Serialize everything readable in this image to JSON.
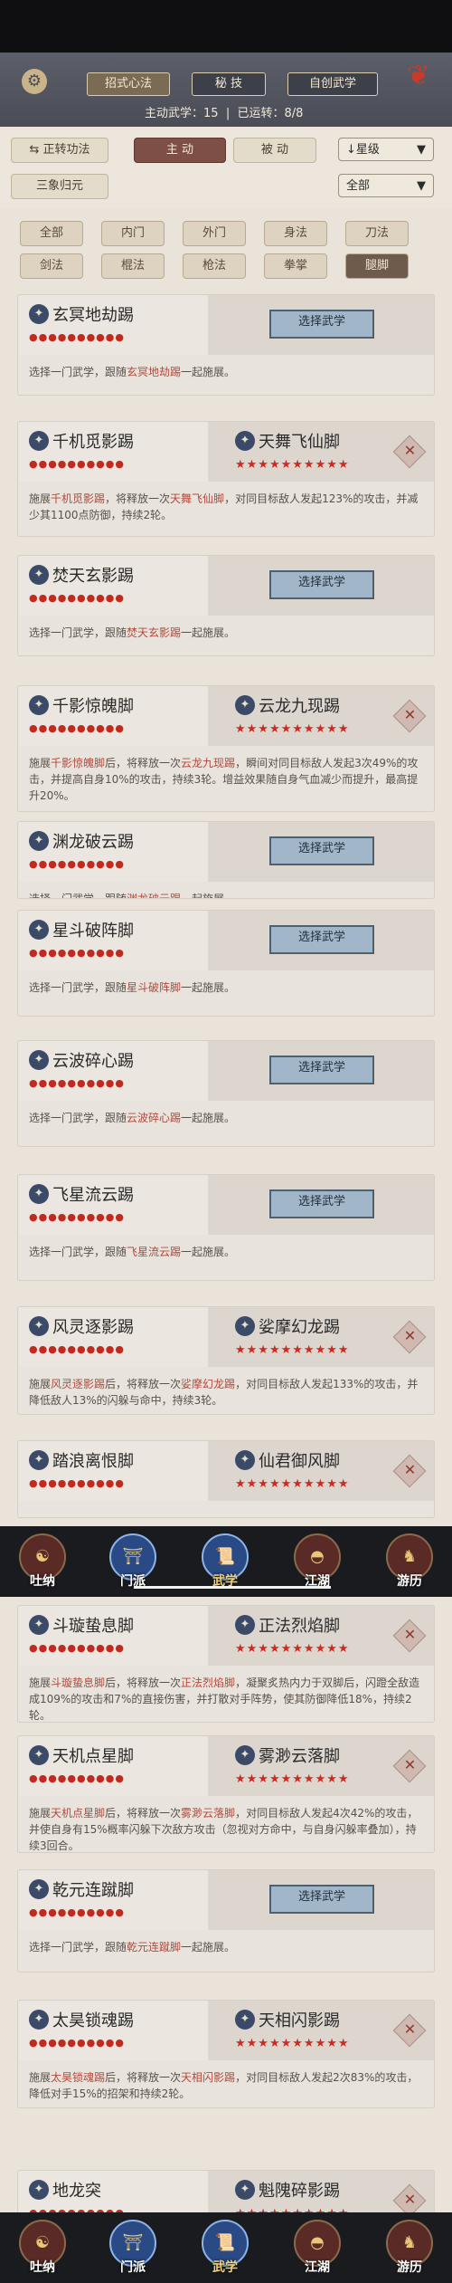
{
  "header": {
    "tabs": [
      "招式心法",
      "秘 技",
      "自创武学"
    ],
    "main_skill_label": "主动武学：",
    "main_skill_value": "15",
    "used_label": "已运转：",
    "used_value": "8/8",
    "knot_icon": "chinese-knot-icon"
  },
  "filters": {
    "reverse_label": "正转功法",
    "active_label": "主 动",
    "passive_label": "被 动",
    "sort_label": "星级",
    "sanxiang_label": "三象归元",
    "scope_label": "全部"
  },
  "categories": [
    "全部",
    "内门",
    "外门",
    "身法",
    "刀法",
    "剑法",
    "棍法",
    "枪法",
    "拳掌",
    "腿脚"
  ],
  "select_label": "选择武学",
  "cards": [
    {
      "name": "玄冥地劫踢",
      "dots": "●●●●●●●●●●",
      "mode": "select",
      "desc_pre": "选择一门武学，跟随",
      "desc_hl": "玄冥地劫踢",
      "desc_post": "一起施展。"
    },
    {
      "name": "千机觅影踢",
      "dots": "●●●●●●●●●●",
      "mode": "paired",
      "partner": "天舞飞仙脚",
      "stars": "★★★★★★★★★★",
      "desc_pre": "施展",
      "desc_hl": "千机觅影踢",
      "desc_post": "，将释放一次",
      "desc_hl2": "天舞飞仙脚",
      "desc_post2": "，对同目标敌人发起123%的攻击，并减少其1100点防御，持续2轮。"
    },
    {
      "name": "焚天玄影踢",
      "dots": "●●●●●●●●●●",
      "mode": "select",
      "desc_pre": "选择一门武学，跟随",
      "desc_hl": "焚天玄影踢",
      "desc_post": "一起施展。"
    },
    {
      "name": "千影惊魄脚",
      "dots": "●●●●●●●●●●",
      "mode": "paired",
      "partner": "云龙九现踢",
      "stars": "★★★★★★★★★★",
      "desc_pre": "施展",
      "desc_hl": "千影惊魄脚",
      "desc_post": "后，将释放一次",
      "desc_hl2": "云龙九现踢",
      "desc_post2": "，瞬间对同目标敌人发起3次49%的攻击，并提高自身10%的攻击，持续3轮。增益效果随自身气血减少而提升，最高提升20%。"
    },
    {
      "name": "渊龙破云踢",
      "dots": "●●●●●●●●●●",
      "mode": "select",
      "desc_pre": "选择一门武学，跟随",
      "desc_hl": "渊龙破云踢",
      "desc_post": "一起施展。"
    },
    {
      "name": "星斗破阵脚",
      "dots": "●●●●●●●●●●",
      "mode": "select",
      "desc_pre": "选择一门武学，跟随",
      "desc_hl": "星斗破阵脚",
      "desc_post": "一起施展。"
    },
    {
      "name": "云波碎心踢",
      "dots": "●●●●●●●●●●",
      "mode": "select",
      "desc_pre": "选择一门武学，跟随",
      "desc_hl": "云波碎心踢",
      "desc_post": "一起施展。"
    },
    {
      "name": "飞星流云踢",
      "dots": "●●●●●●●●●●",
      "mode": "select",
      "desc_pre": "选择一门武学，跟随",
      "desc_hl": "飞星流云踢",
      "desc_post": "一起施展。"
    },
    {
      "name": "风灵逐影踢",
      "dots": "●●●●●●●●●●",
      "mode": "paired",
      "partner": "娑摩幻龙踢",
      "stars": "★★★★★★★★★★",
      "desc_pre": "施展",
      "desc_hl": "风灵逐影踢",
      "desc_post": "后，将释放一次",
      "desc_hl2": "娑摩幻龙踢",
      "desc_post2": "，对同目标敌人发起133%的攻击，并降低敌人13%的闪躲与命中，持续3轮。"
    },
    {
      "name": "踏浪离恨脚",
      "dots": "●●●●●●●●●●",
      "mode": "paired",
      "partner": "仙君御风脚",
      "stars": "★★★★★★★★★★",
      "desc_pre": "",
      "desc_hl": "",
      "desc_post": "",
      "desc_hl2": "",
      "desc_post2": ""
    },
    {
      "name": "斗璇蛰息脚",
      "dots": "●●●●●●●●●●",
      "mode": "paired",
      "partner": "正法烈焰脚",
      "stars": "★★★★★★★★★★",
      "desc_pre": "施展",
      "desc_hl": "斗璇蛰息脚",
      "desc_post": "后，将释放一次",
      "desc_hl2": "正法烈焰脚",
      "desc_post2": "，凝聚炙热内力于双脚后，闪蹬全敌造成109%的攻击和7%的直接伤害，并打散对手阵势，使其防御降低18%，持续2轮。"
    },
    {
      "name": "天机点星脚",
      "dots": "●●●●●●●●●●",
      "mode": "paired",
      "partner": "雾渺云落脚",
      "stars": "★★★★★★★★★★",
      "desc_pre": "施展",
      "desc_hl": "天机点星脚",
      "desc_post": "后，将释放一次",
      "desc_hl2": "雾渺云落脚",
      "desc_post2": "，对同目标敌人发起4次42%的攻击，并使自身有15%概率闪躲下次敌方攻击（忽视对方命中，与自身闪躲率叠加），持续3回合。"
    },
    {
      "name": "乾元连蹴脚",
      "dots": "●●●●●●●●●●",
      "mode": "select",
      "desc_pre": "选择一门武学，跟随",
      "desc_hl": "乾元连蹴脚",
      "desc_post": "一起施展。"
    },
    {
      "name": "太昊锁魂踢",
      "dots": "●●●●●●●●●●",
      "mode": "paired",
      "partner": "天相闪影踢",
      "stars": "★★★★★★★★★★",
      "desc_pre": "施展",
      "desc_hl": "太昊锁魂踢",
      "desc_post": "后，将释放一次",
      "desc_hl2": "天相闪影踢",
      "desc_post2": "，对同目标敌人发起2次83%的攻击，降低对手15%的招架和持续2轮。"
    },
    {
      "name": "地龙突",
      "dots": "●●●●●●●●●●",
      "mode": "paired",
      "partner": "魁隗碎影踢",
      "stars": "★★★★★★★★★★",
      "desc_pre": "",
      "desc_hl": "",
      "desc_post": "",
      "desc_hl2": "",
      "desc_post2": ""
    }
  ],
  "bottom_nav": [
    {
      "label": "吐纳",
      "icon": "warrior-icon"
    },
    {
      "label": "门派",
      "icon": "sect-icon"
    },
    {
      "label": "武学",
      "icon": "scroll-icon"
    },
    {
      "label": "江湖",
      "icon": "straw-hat-icon"
    },
    {
      "label": "游历",
      "icon": "horse-icon"
    }
  ]
}
